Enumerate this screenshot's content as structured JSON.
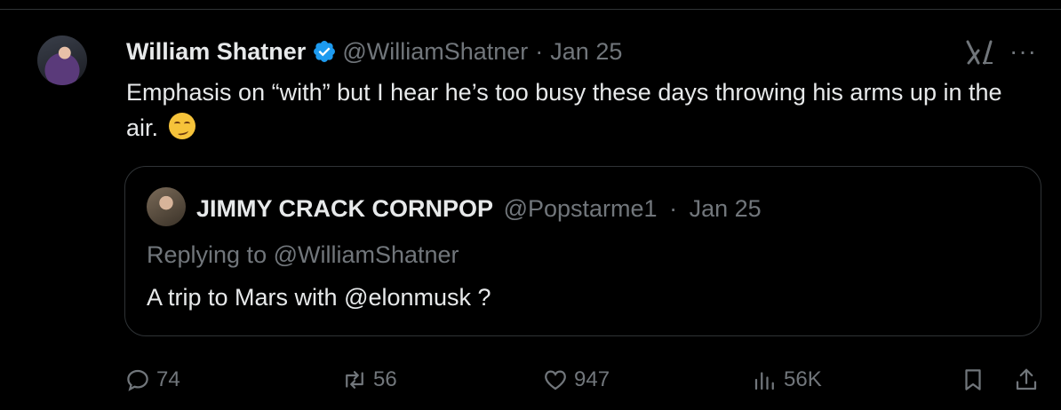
{
  "tweet": {
    "author_name": "William Shatner",
    "author_handle": "@WilliamShatner",
    "separator": "·",
    "date": "Jan 25",
    "text": "Emphasis on “with” but I hear he’s too busy these days throwing his arms up in the air.",
    "emoji": "smirking-face",
    "more_label": "···"
  },
  "quote": {
    "author_name": "JIMMY CRACK CORNPOP",
    "author_handle": "@Popstarme1",
    "separator": "·",
    "date": "Jan 25",
    "replying_to": "Replying to @WilliamShatner",
    "text": "A trip to Mars with @elonmusk ?"
  },
  "actions": {
    "replies": "74",
    "reposts": "56",
    "likes": "947",
    "views": "56K"
  },
  "colors": {
    "background": "#000000",
    "text": "#e7e9ea",
    "muted": "#71767b",
    "border": "#2f3336",
    "verified": "#1d9bf0"
  }
}
